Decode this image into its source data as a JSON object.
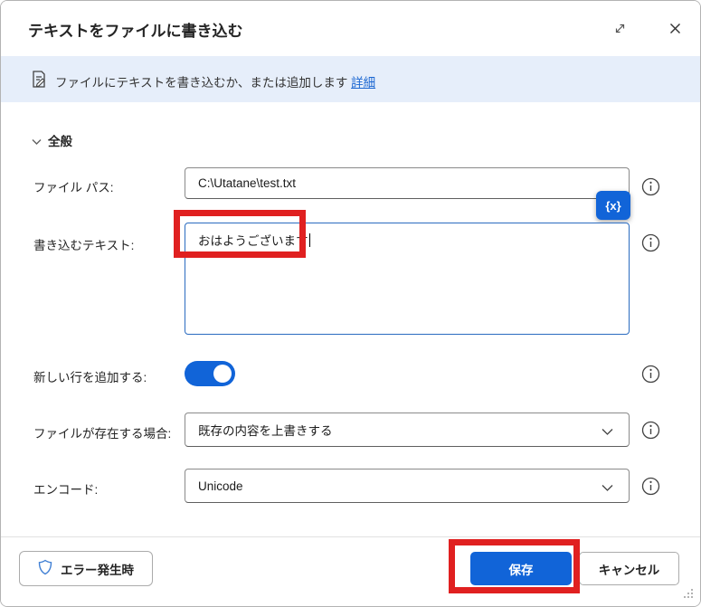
{
  "dialog": {
    "title": "テキストをファイルに書き込む",
    "banner": {
      "message": "ファイルにテキストを書き込むか、または追加します",
      "link_label": "詳細"
    },
    "section_general": {
      "label": "全般"
    },
    "fields": {
      "file_path": {
        "label": "ファイル パス:",
        "value": "C:\\Utatane\\test.txt"
      },
      "text_to_write": {
        "label": "書き込むテキスト:",
        "value": "おはようございます"
      },
      "append_new_line": {
        "label": "新しい行を追加する:",
        "state": "on"
      },
      "if_file_exists": {
        "label": "ファイルが存在する場合:",
        "value": "既存の内容を上書きする"
      },
      "encoding": {
        "label": "エンコード:",
        "value": "Unicode"
      }
    },
    "variable_picker_label": "{x}",
    "footer": {
      "on_error_label": "エラー発生時",
      "save_label": "保存",
      "cancel_label": "キャンセル"
    },
    "colors": {
      "accent_blue": "#1164d8",
      "annotation_red": "#e02020",
      "banner_bg": "#e6eefa",
      "link_blue": "#1a66d1",
      "focus_border_blue": "#2a6bc0"
    }
  }
}
